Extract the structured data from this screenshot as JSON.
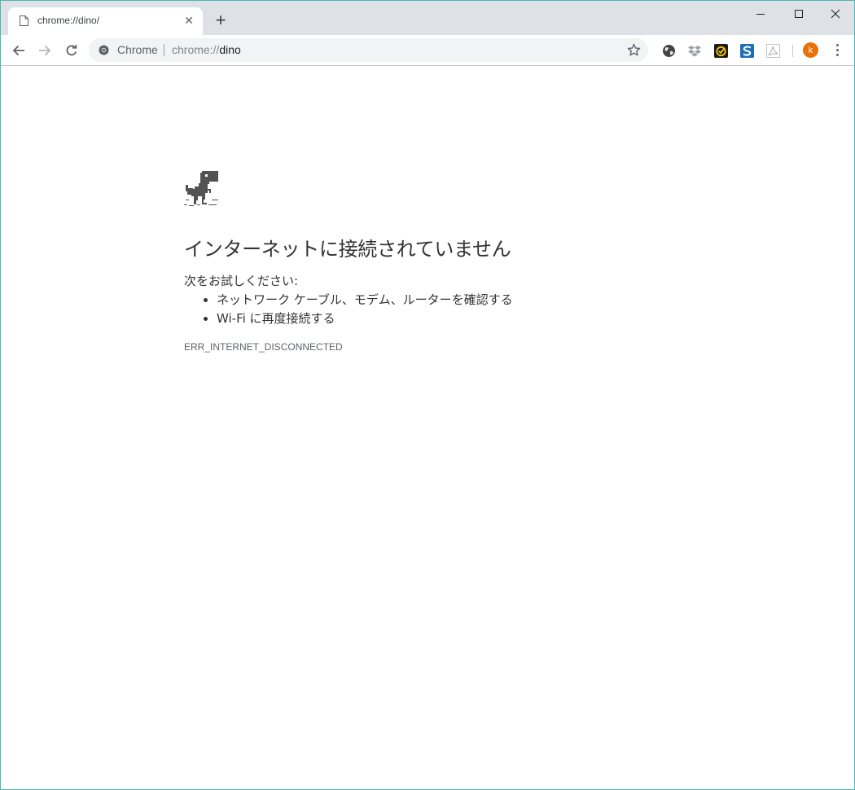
{
  "tab": {
    "title": "chrome://dino/",
    "close": "✕",
    "new_tab": "+"
  },
  "omnibox": {
    "chip": "Chrome",
    "scheme": "chrome://",
    "host": "dino"
  },
  "error": {
    "heading": "インターネットに接続されていません",
    "suggest_label": "次をお試しください:",
    "suggestions": [
      "ネットワーク ケーブル、モデム、ルーターを確認する",
      "Wi-Fi に再度接続する"
    ],
    "code": "ERR_INTERNET_DISCONNECTED"
  },
  "profile": {
    "initial": "k"
  },
  "colors": {
    "avatar": "#e8710a",
    "tab_strip": "#dee1e6",
    "omnibox_bg": "#f1f3f4"
  }
}
